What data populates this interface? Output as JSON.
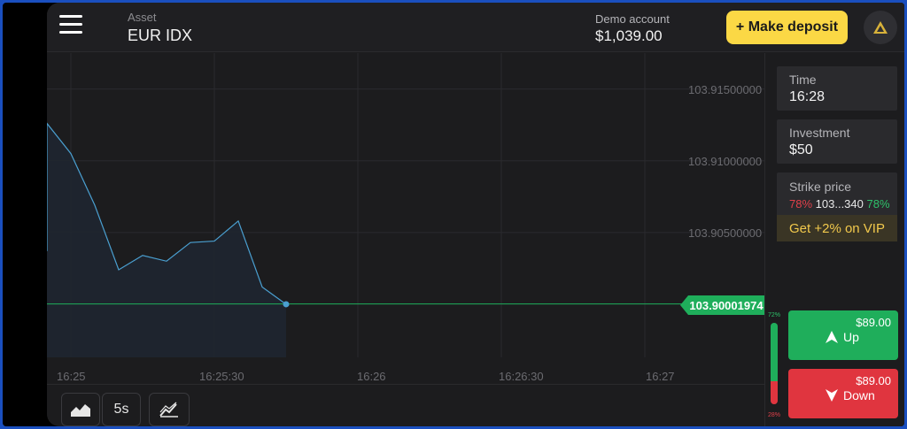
{
  "header": {
    "asset_label": "Asset",
    "asset_name": "EUR IDX",
    "account_label": "Demo account",
    "account_balance": "$1,039.00",
    "deposit_label": "+ Make deposit",
    "icons": {
      "menu": "hamburger-menu-icon",
      "profile": "triangle-logo-icon"
    }
  },
  "chart_data": {
    "type": "area",
    "asset": "EUR IDX",
    "x": [
      "16:24:50",
      "16:24:55",
      "16:25:00",
      "16:25:05",
      "16:25:10",
      "16:25:15",
      "16:25:20",
      "16:25:25",
      "16:25:30",
      "16:25:35",
      "16:25:40",
      "16:25:45"
    ],
    "values": [
      103.9037,
      103.9126,
      103.9105,
      103.9069,
      103.9024,
      103.9034,
      103.903,
      103.9043,
      103.9044,
      103.9058,
      103.9012,
      103.9
    ],
    "current_price": "103.90001974",
    "y_ticks": [
      "103.91500000",
      "103.91000000",
      "103.90500000"
    ],
    "y_tick_values": [
      103.915,
      103.91,
      103.905
    ],
    "x_ticks": [
      "16:25",
      "16:25:30",
      "16:26",
      "16:26:30",
      "16:27"
    ],
    "ylim": [
      103.8963,
      103.9175
    ],
    "grid": true,
    "colors": {
      "line": "#4a9fd0",
      "fill": "#1f2630",
      "price_line": "#1fae5b",
      "grid": "#2a2a2e"
    }
  },
  "toolbar": {
    "chart_type_icon": "area-chart-icon",
    "timeframe": "5s",
    "indicators_icon": "indicators-chart-icon"
  },
  "sidebar": {
    "time": {
      "label": "Time",
      "value": "16:28"
    },
    "investment": {
      "label": "Investment",
      "value": "$50"
    },
    "strike": {
      "label": "Strike price",
      "pct_left": "78%",
      "value": "103...340",
      "pct_right": "78%"
    },
    "vip": "Get +2% on VIP",
    "meter": {
      "up_pct": "72%",
      "down_pct": "28%"
    },
    "up": {
      "amount": "$89.00",
      "label": "Up",
      "icon": "arrow-up-icon"
    },
    "down": {
      "amount": "$89.00",
      "label": "Down",
      "icon": "arrow-down-icon"
    }
  },
  "colors": {
    "accent": "#fbd845",
    "up": "#1fae5b",
    "down": "#e0353f",
    "background": "#1c1c1e"
  }
}
